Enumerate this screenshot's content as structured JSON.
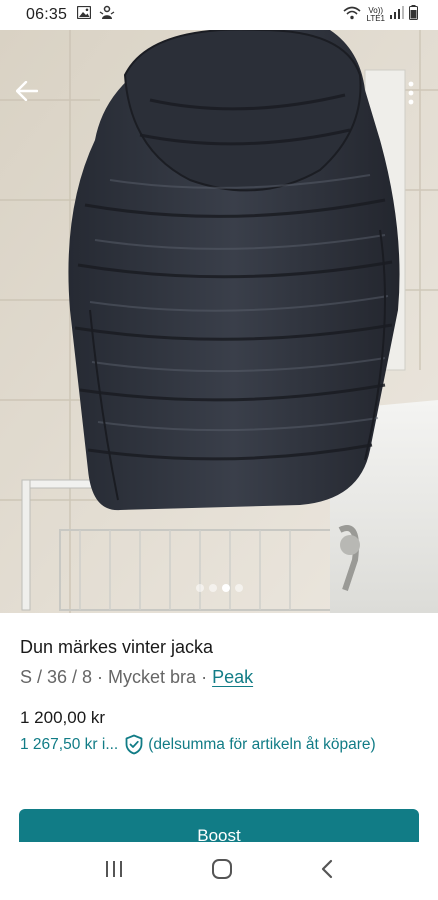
{
  "status_bar": {
    "time": "06:35",
    "network_top": "Vo))",
    "network_bottom": "LTE1",
    "icons": [
      "gallery-icon",
      "notification-icon",
      "wifi-icon",
      "signal-icon",
      "battery-icon"
    ]
  },
  "gallery": {
    "image_count": 4,
    "active_index": 2,
    "image_description_icon": "photo-jacket"
  },
  "listing": {
    "title": "Dun märkes vinter jacka",
    "meta_prefix": "S / 36 / 8 · Mycket bra · ",
    "brand": "Peak",
    "price": "1 200,00 kr",
    "price_incl": "1 267,50 kr",
    "price_incl_truncation": "i...",
    "protection_note": "(delsumma för artikeln åt köpare)"
  },
  "actions": {
    "boost_label": "Boost"
  },
  "colors": {
    "accent": "#117c86",
    "text": "#1a1a1a",
    "muted": "#666666"
  }
}
